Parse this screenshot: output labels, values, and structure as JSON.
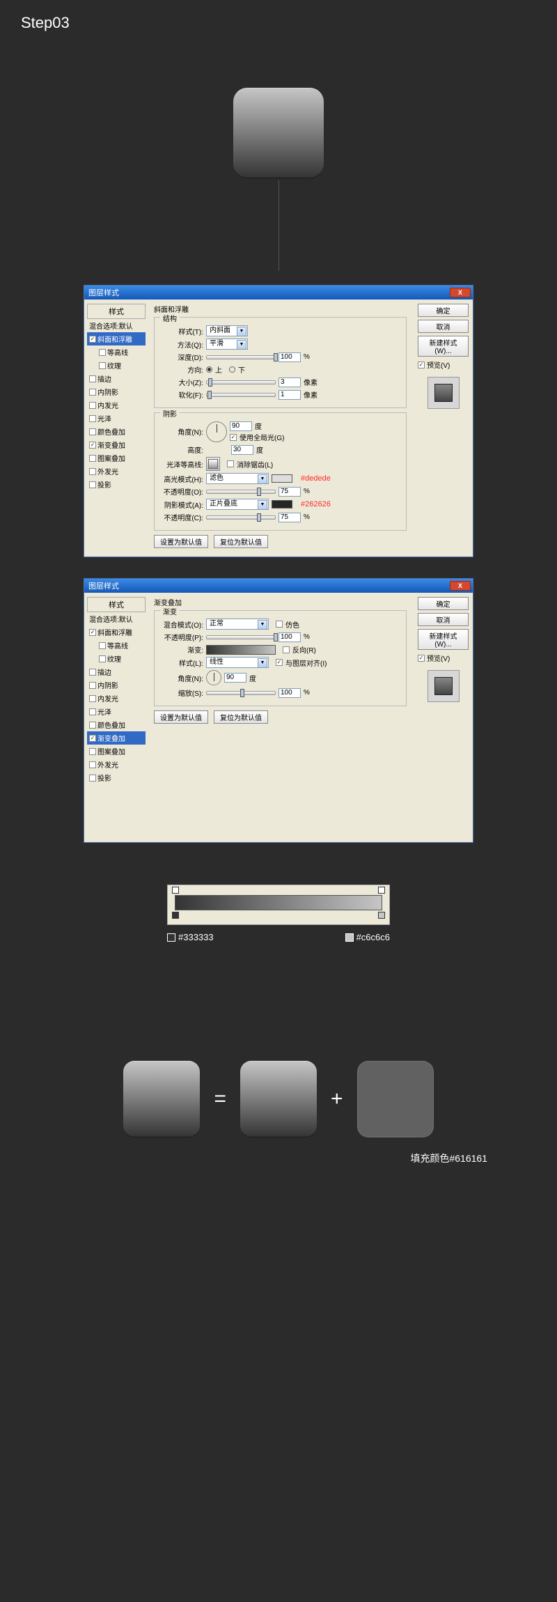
{
  "step_title": "Step03",
  "dialog_title": "图层样式",
  "close_x": "X",
  "styles": {
    "header": "样式",
    "mix_default": "混合选项:默认",
    "bevel_emboss": "斜面和浮雕",
    "contour": "等高线",
    "texture": "纹理",
    "stroke": "描边",
    "inner_shadow": "内阴影",
    "inner_glow": "内发光",
    "satin": "光泽",
    "color_overlay": "颜色叠加",
    "grad_overlay": "渐变叠加",
    "pattern_overlay": "图案叠加",
    "outer_glow": "外发光",
    "drop_shadow": "投影"
  },
  "buttons": {
    "ok": "确定",
    "cancel": "取消",
    "new_style": "新建样式(W)...",
    "preview": "预览(V)",
    "set_default": "设置为默认值",
    "reset_default": "复位为默认值"
  },
  "bevel": {
    "panel_title": "斜面和浮雕",
    "structure": "结构",
    "style_label": "样式(T):",
    "style_value": "内斜面",
    "method_label": "方法(Q):",
    "method_value": "平滑",
    "depth_label": "深度(D):",
    "depth_value": "100",
    "percent": "%",
    "direction_label": "方向:",
    "dir_up": "上",
    "dir_down": "下",
    "size_label": "大小(Z):",
    "size_value": "3",
    "pixel": "像素",
    "soften_label": "软化(F):",
    "soften_value": "1",
    "shading": "阴影",
    "angle_label": "角度(N):",
    "angle_value": "90",
    "degree": "度",
    "global_light": "使用全局光(G)",
    "altitude_label": "高度:",
    "altitude_value": "30",
    "gloss_contour_label": "光泽等高线:",
    "antialias": "消除锯齿(L)",
    "highlight_mode_label": "高光模式(H):",
    "highlight_mode_value": "滤色",
    "highlight_color": "#dedede",
    "highlight_opacity_label": "不透明度(O):",
    "highlight_opacity_value": "75",
    "shadow_mode_label": "阴影模式(A):",
    "shadow_mode_value": "正片叠底",
    "shadow_color": "#262626",
    "shadow_opacity_label": "不透明度(C):",
    "shadow_opacity_value": "75",
    "annot_highlight": "#dedede",
    "annot_shadow": "#262626"
  },
  "grad": {
    "panel_title": "渐变叠加",
    "section": "渐变",
    "blend_label": "混合模式(O):",
    "blend_value": "正常",
    "dither": "仿色",
    "opacity_label": "不透明度(P):",
    "opacity_value": "100",
    "gradient_label": "渐变:",
    "reverse": "反向(R)",
    "style_label": "样式(L):",
    "style_value": "线性",
    "align_layer": "与图层对齐(I)",
    "angle_label": "角度(N):",
    "angle_value": "90",
    "degree": "度",
    "scale_label": "缩放(S):",
    "scale_value": "100",
    "percent": "%"
  },
  "gradient_editor": {
    "left": "#333333",
    "right": "#c6c6c6"
  },
  "formula": {
    "equals": "=",
    "plus": "+",
    "fill_note": "填充颜色#616161",
    "fill_color": "#616161"
  }
}
